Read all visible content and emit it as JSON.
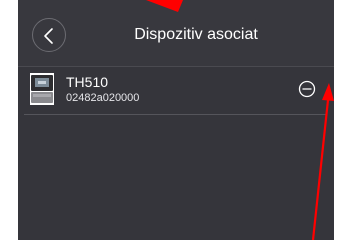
{
  "header": {
    "title": "Dispozitiv asociat",
    "back_icon": "chevron-left-icon"
  },
  "devices": [
    {
      "name": "TH510",
      "id": "02482a020000",
      "thumbnail_icon": "thermostat-icon",
      "remove_icon": "minus-circle-icon"
    }
  ],
  "colors": {
    "background": "#35353b",
    "header": "#38383e",
    "text": "#ffffff",
    "annotation": "#ff0000"
  }
}
